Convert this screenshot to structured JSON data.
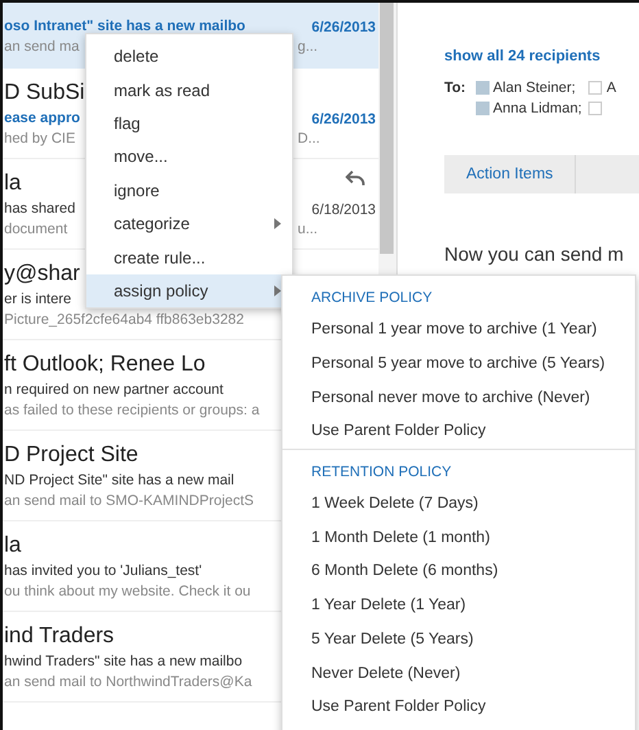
{
  "mail_list": {
    "messages": [
      {
        "subject": {
          "left": "oso Intranet\" site has a new mailbo"
        },
        "date": "6/26/2013",
        "preview": {
          "left": "an send ma",
          "right": "g..."
        },
        "unread": true,
        "selected": true,
        "replied": false
      },
      {
        "title": {
          "left": "D SubSi"
        },
        "subject": {
          "left": "ease appro"
        },
        "date": "6/26/2013",
        "preview": {
          "left": "hed by CIE",
          "right": "D..."
        },
        "unread": true,
        "selected": false,
        "replied": false
      },
      {
        "title": {
          "left": "la"
        },
        "subject": {
          "left": "has shared"
        },
        "date": "6/18/2013",
        "preview": {
          "left": "document",
          "right": "u..."
        },
        "unread": false,
        "selected": false,
        "replied": true
      },
      {
        "title": {
          "left": "y@shar"
        },
        "subject": {
          "left": "er is intere"
        },
        "preview": {
          "left": "Picture_265f2cfe64ab4 ffb863eb3282"
        },
        "unread": false,
        "selected": false,
        "replied": false
      },
      {
        "title": {
          "left": "ft Outlook; Renee Lo"
        },
        "subject": {
          "left": "n required on new partner account"
        },
        "preview": {
          "left": "as failed to these recipients or groups: a"
        },
        "unread": false,
        "selected": false,
        "replied": false
      },
      {
        "title": {
          "left": "D Project Site"
        },
        "subject": {
          "left": "ND Project Site\" site has a new mail"
        },
        "preview": {
          "left": "an send mail to SMO-KAMINDProjectS"
        },
        "unread": false,
        "selected": false,
        "replied": false
      },
      {
        "title": {
          "left": "la"
        },
        "subject": {
          "left": "has invited you to 'Julians_test'"
        },
        "preview": {
          "left": "ou think about my website. Check it ou"
        },
        "unread": false,
        "selected": false,
        "replied": false
      },
      {
        "title": {
          "left": "ind Traders"
        },
        "subject": {
          "left": "hwind Traders\" site has a new mailbo"
        },
        "preview": {
          "left": "an send mail to NorthwindTraders@Ka"
        },
        "unread": false,
        "selected": false,
        "replied": false
      }
    ]
  },
  "reading_pane": {
    "show_all": "show all 24 recipients",
    "to_label": "To:",
    "recipients": [
      {
        "name": "Alan Steiner;",
        "color": "#b5c8d6"
      },
      {
        "name": "A",
        "color": "#ffffff"
      },
      {
        "name": "Anna Lidman;",
        "color": "#b5c8d6"
      },
      {
        "color": "#ffffff"
      }
    ],
    "tabs": [
      {
        "label": "Action Items"
      }
    ],
    "body": "Now you can send m"
  },
  "context_menu": {
    "items": [
      {
        "label": "delete",
        "submenu": false,
        "selected": false
      },
      {
        "label": "mark as read",
        "submenu": false,
        "selected": false
      },
      {
        "label": "flag",
        "submenu": false,
        "selected": false
      },
      {
        "label": "move...",
        "submenu": false,
        "selected": false
      },
      {
        "label": "ignore",
        "submenu": false,
        "selected": false
      },
      {
        "label": "categorize",
        "submenu": true,
        "selected": false
      },
      {
        "label": "create rule...",
        "submenu": false,
        "selected": false
      },
      {
        "label": "assign policy",
        "submenu": true,
        "selected": true
      }
    ]
  },
  "submenu": {
    "sections": [
      {
        "header": "ARCHIVE POLICY",
        "items": [
          "Personal 1 year move to archive (1 Year)",
          "Personal 5 year move to archive (5 Years)",
          "Personal never move to archive (Never)",
          "Use Parent Folder Policy"
        ]
      },
      {
        "header": "RETENTION POLICY",
        "items": [
          "1 Week Delete (7 Days)",
          "1 Month Delete (1 month)",
          "6 Month Delete (6 months)",
          "1 Year Delete (1 Year)",
          "5 Year Delete (5 Years)",
          "Never Delete (Never)",
          "Use Parent Folder Policy"
        ]
      }
    ]
  }
}
